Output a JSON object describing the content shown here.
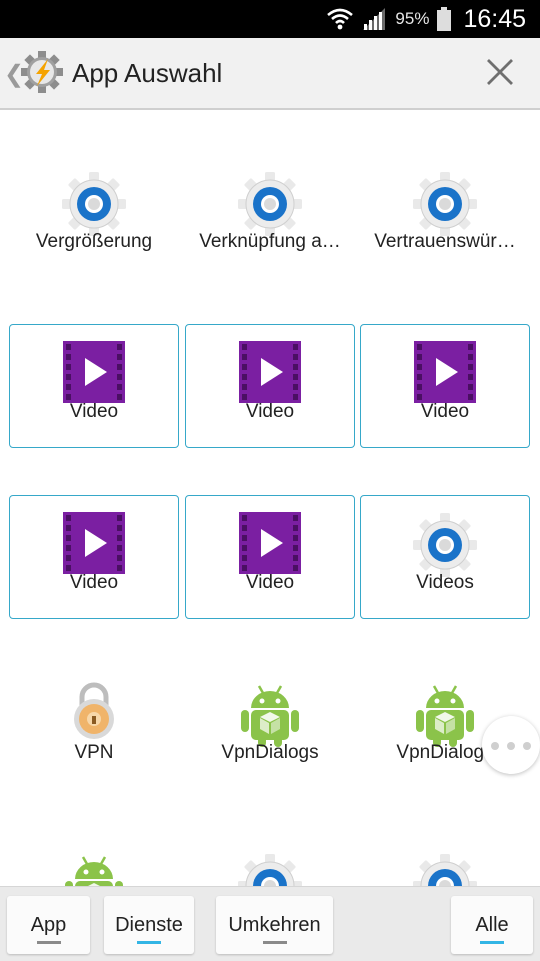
{
  "status_bar": {
    "battery_percent": "95%",
    "time": "16:45"
  },
  "header": {
    "title": "App Auswahl"
  },
  "grid": {
    "items": [
      {
        "label": "Vergrößerung",
        "icon": "gear-icon",
        "selected": false
      },
      {
        "label": "Verknüpfung a…",
        "icon": "gear-icon",
        "selected": false
      },
      {
        "label": "Vertrauenswür…",
        "icon": "gear-icon",
        "selected": false
      },
      {
        "label": "Video",
        "icon": "video-icon",
        "selected": true
      },
      {
        "label": "Video",
        "icon": "video-icon",
        "selected": true
      },
      {
        "label": "Video",
        "icon": "video-icon",
        "selected": true
      },
      {
        "label": "Video",
        "icon": "video-icon",
        "selected": true
      },
      {
        "label": "Video",
        "icon": "video-icon",
        "selected": true
      },
      {
        "label": "Videos",
        "icon": "gear-icon",
        "selected": true
      },
      {
        "label": "VPN",
        "icon": "lock-icon",
        "selected": false
      },
      {
        "label": "VpnDialogs",
        "icon": "android-icon",
        "selected": false
      },
      {
        "label": "VpnDialogs",
        "icon": "android-icon",
        "selected": false
      },
      {
        "label": "",
        "icon": "android-icon",
        "selected": false
      },
      {
        "label": "",
        "icon": "gear-icon",
        "selected": false
      },
      {
        "label": "",
        "icon": "gear-icon",
        "selected": false
      }
    ]
  },
  "bottom_bar": {
    "buttons": [
      {
        "label": "App",
        "active": false
      },
      {
        "label": "Dienste",
        "active": true
      },
      {
        "label": "Umkehren",
        "active": false
      },
      {
        "label": "Alle",
        "active": true
      }
    ]
  },
  "colors": {
    "accent": "#33b5e5",
    "selected_border": "#36a8c9",
    "video_purple": "#7b1fa2",
    "gear_blue": "#1565c0"
  }
}
